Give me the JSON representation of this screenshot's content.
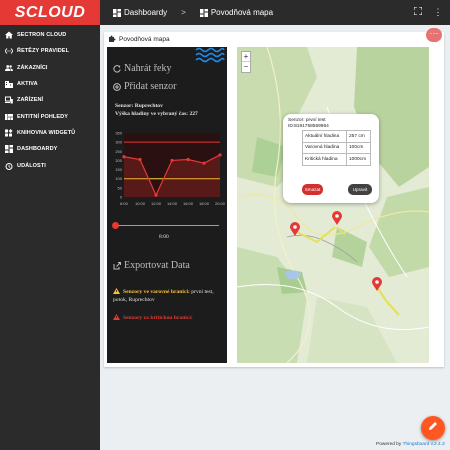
{
  "app": {
    "logo": "SCLOUD"
  },
  "header": {
    "breadcrumb": [
      {
        "label": "Dashboardy"
      },
      {
        "label": "Povodňová mapa"
      }
    ],
    "separator": ">"
  },
  "sidebar": {
    "items": [
      {
        "label": "SECTRON CLOUD",
        "icon": "home-icon"
      },
      {
        "label": "ŘETĚZY PRAVIDEL",
        "icon": "settings-ethernet-icon"
      },
      {
        "label": "ZÁKAZNÍCI",
        "icon": "people-icon"
      },
      {
        "label": "AKTIVA",
        "icon": "domain-icon"
      },
      {
        "label": "ZAŘÍZENÍ",
        "icon": "devices-icon"
      },
      {
        "label": "ENTITNÍ POHLEDY",
        "icon": "view-quilt-icon"
      },
      {
        "label": "KNIHOVNA WIDGETŮ",
        "icon": "widgets-icon"
      },
      {
        "label": "DASHBOARDY",
        "icon": "dashboard-icon"
      },
      {
        "label": "UDÁLOSTI",
        "icon": "alarm-icon"
      }
    ]
  },
  "widget": {
    "title": "Povodňová mapa",
    "panel": {
      "refresh_link": "Nahrát řeky",
      "add_link": "Přidat senzor",
      "sensor_line1": "Senzor: Ruprechtov",
      "sensor_line2": "Výška hladiny ve vybraný čas: 227",
      "time_label": "8:00",
      "export_link": "Exportovat Data",
      "warn_yellow_label": "Senzory ve varovné hranici:",
      "warn_yellow_text": " první test, potok, Ruprechtov",
      "warn_red_label": "Senzory za kritickou hranicí:",
      "warn_red_text": ""
    },
    "map": {
      "zoom_in": "+",
      "zoom_out": "−",
      "popup": {
        "sensor_line": "Senzor: první test",
        "id_line": "ID:8191758559964",
        "rows": [
          {
            "key": "Aktuální hladina",
            "value": "257 cm"
          },
          {
            "key": "Varovná hladina",
            "value": "100cm"
          },
          {
            "key": "Kritická hladina",
            "value": "1000cm"
          }
        ],
        "delete_label": "Smazat",
        "edit_label": "Upravit"
      }
    }
  },
  "footer": {
    "powered": "Powered by ",
    "brand": "Thingsboard v.2.4.3"
  },
  "colors": {
    "accent": "#e53935",
    "sidebar": "#2b2b2b",
    "fab": "#ff5722"
  },
  "chart_data": {
    "type": "line",
    "x": [
      "8:00",
      "10:00",
      "12:00",
      "14:00",
      "16:00",
      "18:00",
      "20:00"
    ],
    "series": [
      {
        "values": [
          220,
          205,
          10,
          200,
          205,
          185,
          230
        ]
      }
    ],
    "thresholds": {
      "critical": 300,
      "warning": 100
    },
    "ylim": [
      0,
      350
    ],
    "yticks": [
      0,
      50,
      100,
      150,
      200,
      250,
      300,
      350
    ]
  }
}
